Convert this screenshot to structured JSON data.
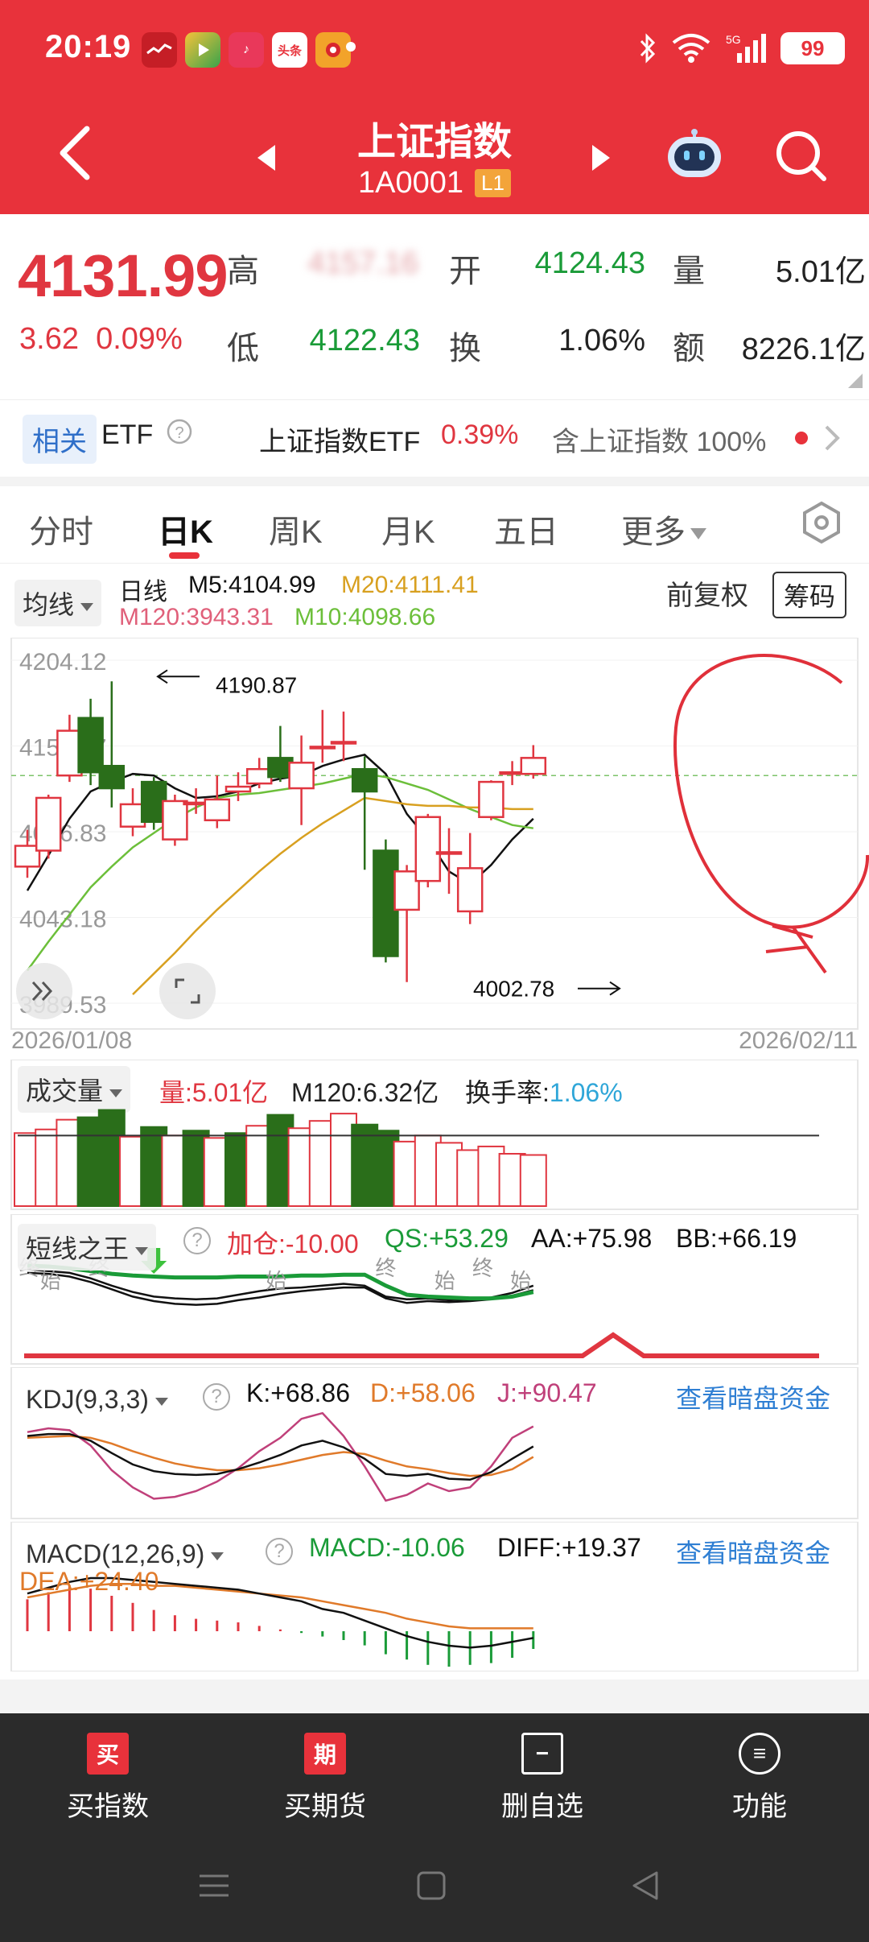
{
  "status_bar": {
    "time": "20:19",
    "battery": "99",
    "network": "5G",
    "app_icons": [
      {
        "name": "app-red-icon",
        "label": "",
        "color": "#d9262d"
      },
      {
        "name": "video-app-icon",
        "label": "",
        "color": "#3aa34b"
      },
      {
        "name": "music-app-icon",
        "label": "♪",
        "color": "#e9385a"
      },
      {
        "name": "toutiao-app-icon",
        "label": "头条",
        "color": "#ef3b3b"
      },
      {
        "name": "news-app-icon",
        "label": "",
        "color": "#f2a32a"
      }
    ]
  },
  "header": {
    "title": "上证指数",
    "code": "1A0001",
    "level": "L1",
    "bg_color": "#e8323b"
  },
  "quote": {
    "price": "4131.99",
    "change": "3.62",
    "change_pct": "0.09%",
    "labels": {
      "high": "高",
      "open": "开",
      "volume": "量",
      "low": "低",
      "turnover": "换",
      "amount": "额"
    },
    "high": "4157.16",
    "open": "4124.43",
    "volume": "5.01亿",
    "low": "4122.43",
    "turnover": "1.06%",
    "amount": "8226.1亿"
  },
  "etf": {
    "tag": "相关",
    "label": "ETF",
    "name": "上证指数ETF",
    "pct": "0.39%",
    "holding": "含上证指数 100%"
  },
  "tabs": [
    {
      "label": "分时"
    },
    {
      "label": "日K",
      "active": true
    },
    {
      "label": "周K"
    },
    {
      "label": "月K"
    },
    {
      "label": "五日"
    },
    {
      "label": "更多"
    }
  ],
  "ma_bar": {
    "selector": "均线",
    "period": "日线",
    "m5": "M5:4104.99",
    "m20": "M20:4111.41",
    "m120": "M120:3943.31",
    "m10": "M10:4098.66",
    "adjust": "前复权",
    "chips": "筹码"
  },
  "colors": {
    "up": "#e03640",
    "down": "#2a6e1a",
    "m5": "#111111",
    "m10": "#6cbf3a",
    "m20": "#d8a020",
    "m120": "#e0607a",
    "annotation": "#e0303a"
  },
  "kline_chart": {
    "y_ticks": [
      "4204.12",
      "4150.47",
      "4096.83",
      "4043.18",
      "3989.53"
    ],
    "date_start": "2026/01/08",
    "date_end": "2026/02/11",
    "high_mark": "4190.87",
    "low_mark": "4002.78"
  },
  "chart_data": {
    "type": "candlestick",
    "x": [
      "2026/01/08",
      "",
      "",
      "",
      "",
      "",
      "",
      "",
      "",
      "",
      "",
      "",
      "",
      "",
      "",
      "",
      "",
      "",
      "",
      "",
      "",
      "",
      "",
      "",
      "2026/02/11"
    ],
    "ylim": [
      3989.53,
      4204.12
    ],
    "y_ticks": [
      4204.12,
      4150.47,
      4096.83,
      4043.18,
      3989.53
    ],
    "candles": [
      {
        "o": 4075,
        "c": 4088,
        "h": 4098,
        "l": 4068
      },
      {
        "o": 4085,
        "c": 4118,
        "h": 4120,
        "l": 4080
      },
      {
        "o": 4132,
        "c": 4160,
        "h": 4170,
        "l": 4128
      },
      {
        "o": 4168,
        "c": 4134,
        "h": 4180,
        "l": 4126
      },
      {
        "o": 4138,
        "c": 4124,
        "h": 4190.87,
        "l": 4112
      },
      {
        "o": 4100,
        "c": 4114,
        "h": 4124,
        "l": 4094
      },
      {
        "o": 4128,
        "c": 4103,
        "h": 4131,
        "l": 4098
      },
      {
        "o": 4092,
        "c": 4116,
        "h": 4120,
        "l": 4088
      },
      {
        "o": 4114,
        "c": 4115,
        "h": 4124,
        "l": 4108
      },
      {
        "o": 4104,
        "c": 4117,
        "h": 4132,
        "l": 4099
      },
      {
        "o": 4122,
        "c": 4125,
        "h": 4134,
        "l": 4116
      },
      {
        "o": 4127,
        "c": 4136,
        "h": 4143,
        "l": 4124
      },
      {
        "o": 4143,
        "c": 4131,
        "h": 4163,
        "l": 4128
      },
      {
        "o": 4124,
        "c": 4140,
        "h": 4157,
        "l": 4101
      },
      {
        "o": 4149,
        "c": 4150,
        "h": 4173,
        "l": 4140
      },
      {
        "o": 4152,
        "c": 4153,
        "h": 4172,
        "l": 4141
      },
      {
        "o": 4136,
        "c": 4122,
        "h": 4144,
        "l": 4073
      },
      {
        "o": 4085,
        "c": 4019,
        "h": 4092,
        "l": 4015
      },
      {
        "o": 4048,
        "c": 4072,
        "h": 4076,
        "l": 4002.78
      },
      {
        "o": 4066,
        "c": 4106,
        "h": 4108,
        "l": 4062
      },
      {
        "o": 4083,
        "c": 4084,
        "h": 4099,
        "l": 4058
      },
      {
        "o": 4047,
        "c": 4074,
        "h": 4096,
        "l": 4039
      },
      {
        "o": 4106,
        "c": 4128,
        "h": 4129,
        "l": 4104
      },
      {
        "o": 4133,
        "c": 4134,
        "h": 4141,
        "l": 4126
      },
      {
        "o": 4133,
        "c": 4143,
        "h": 4151,
        "l": 4130
      }
    ],
    "series": [
      {
        "name": "M5",
        "values": [
          4060,
          4082,
          4105,
          4122,
          4128,
          4133,
          4132,
          4124,
          4118,
          4119,
          4122,
          4127,
          4130,
          4132,
          4138,
          4142,
          4145,
          4133,
          4108,
          4092,
          4072,
          4064,
          4076,
          4092,
          4105
        ]
      },
      {
        "name": "M10",
        "values": [
          4010,
          4028,
          4045,
          4062,
          4075,
          4087,
          4096,
          4105,
          4112,
          4118,
          4120,
          4121,
          4123,
          4125,
          4127,
          4130,
          4133,
          4131,
          4127,
          4123,
          4117,
          4111,
          4106,
          4101,
          4099
        ]
      },
      {
        "name": "M20",
        "values": [
          null,
          null,
          null,
          null,
          null,
          3995,
          4008,
          4021,
          4035,
          4048,
          4060,
          4072,
          4083,
          4093,
          4102,
          4110,
          4118,
          4116,
          4114,
          4113,
          4113,
          4112,
          4112,
          4111,
          4111
        ]
      },
      {
        "name": "M120",
        "values": []
      }
    ]
  },
  "volume_panel": {
    "selector": "成交量",
    "vol": "量:5.01亿",
    "m120": "M120:6.32亿",
    "turnover_label": "换手率:",
    "turnover_val": "1.06%",
    "bars": [
      {
        "v": 6.0,
        "up": true
      },
      {
        "v": 6.3,
        "up": true
      },
      {
        "v": 7.1,
        "up": true
      },
      {
        "v": 7.3,
        "up": false
      },
      {
        "v": 7.9,
        "up": false
      },
      {
        "v": 5.7,
        "up": true
      },
      {
        "v": 6.5,
        "up": false
      },
      {
        "v": 5.8,
        "up": true
      },
      {
        "v": 6.2,
        "up": false
      },
      {
        "v": 5.6,
        "up": true
      },
      {
        "v": 6.0,
        "up": false
      },
      {
        "v": 6.6,
        "up": true
      },
      {
        "v": 7.5,
        "up": false
      },
      {
        "v": 6.4,
        "up": true
      },
      {
        "v": 7.0,
        "up": true
      },
      {
        "v": 7.6,
        "up": true
      },
      {
        "v": 6.7,
        "up": false
      },
      {
        "v": 6.2,
        "up": false
      },
      {
        "v": 5.3,
        "up": true
      },
      {
        "v": 5.8,
        "up": true
      },
      {
        "v": 5.2,
        "up": true
      },
      {
        "v": 4.6,
        "up": true
      },
      {
        "v": 4.9,
        "up": true
      },
      {
        "v": 4.3,
        "up": true
      },
      {
        "v": 4.2,
        "up": true
      }
    ],
    "ref_level": 5.8,
    "max": 8.6
  },
  "dxzw_panel": {
    "selector": "短线之王",
    "jc": "加仓:-10.00",
    "qs": "QS:+53.29",
    "aa": "AA:+75.98",
    "bb": "BB:+66.19",
    "marks": [
      {
        "text": "终",
        "i": 0.1
      },
      {
        "text": "始",
        "i": 1.1
      },
      {
        "text": "终",
        "i": 3.4
      },
      {
        "text": "始",
        "i": 11.8
      },
      {
        "text": "终",
        "i": 17.0
      },
      {
        "text": "始",
        "i": 19.8
      },
      {
        "text": "终",
        "i": 21.6
      },
      {
        "text": "始",
        "i": 23.4
      }
    ],
    "down_arrow_i": 6.0,
    "qs_line": [
      92,
      91,
      89,
      86,
      83,
      81,
      80,
      79,
      79,
      79,
      80,
      80,
      80,
      81,
      81,
      82,
      82,
      70,
      60,
      58,
      57,
      56,
      56,
      58,
      63
    ],
    "aa_line": [
      88,
      86,
      84,
      78,
      70,
      63,
      58,
      56,
      55,
      56,
      60,
      64,
      67,
      68,
      70,
      72,
      70,
      58,
      55,
      56,
      54,
      55,
      57,
      62,
      70
    ],
    "bb_line": [
      84,
      83,
      80,
      74,
      66,
      58,
      53,
      50,
      49,
      50,
      54,
      57,
      61,
      64,
      66,
      68,
      68,
      56,
      51,
      53,
      52,
      53,
      55,
      59,
      65
    ]
  },
  "kdj_panel": {
    "selector": "KDJ(9,3,3)",
    "k": "K:+68.86",
    "d": "D:+58.06",
    "j": "J:+90.47",
    "link": "查看暗盘资金",
    "k_line": [
      80,
      82,
      82,
      75,
      62,
      50,
      43,
      40,
      39,
      40,
      45,
      52,
      60,
      70,
      75,
      68,
      56,
      40,
      38,
      40,
      35,
      34,
      42,
      56,
      69
    ],
    "d_line": [
      78,
      79,
      80,
      78,
      72,
      64,
      57,
      51,
      47,
      44,
      44,
      46,
      50,
      55,
      60,
      63,
      61,
      54,
      48,
      45,
      41,
      38,
      39,
      45,
      58
    ],
    "j_line": [
      84,
      88,
      86,
      70,
      44,
      26,
      14,
      16,
      22,
      32,
      46,
      64,
      78,
      98,
      104,
      80,
      48,
      12,
      18,
      30,
      22,
      26,
      48,
      78,
      90
    ]
  },
  "macd_panel": {
    "selector": "MACD(12,26,9)",
    "macd": "MACD:-10.06",
    "diff": "DIFF:+19.37",
    "dea": "DEA:+24.40",
    "link": "查看暗盘资金",
    "diff_line": [
      42,
      45,
      48,
      50,
      50,
      49,
      48,
      47,
      46,
      45,
      44,
      42,
      40,
      38,
      34,
      32,
      28,
      24,
      20,
      17,
      15,
      14,
      15,
      17,
      19
    ],
    "dea_line": [
      40,
      42,
      44,
      46,
      47,
      47,
      46,
      46,
      45,
      44,
      43,
      42,
      41,
      40,
      38,
      36,
      34,
      32,
      29,
      27,
      25,
      24,
      24,
      24,
      24
    ],
    "hist": [
      18,
      22,
      26,
      24,
      20,
      16,
      12,
      9,
      7,
      6,
      5,
      3,
      1,
      -1,
      -3,
      -5,
      -8,
      -13,
      -16,
      -19,
      -20,
      -19,
      -18,
      -15,
      -10
    ]
  },
  "bottom_bar": [
    {
      "name": "buy-index-button",
      "icon": "买",
      "label": "买指数"
    },
    {
      "name": "buy-futures-button",
      "icon": "期",
      "label": "买期货"
    },
    {
      "name": "remove-watchlist-button",
      "icon": "−",
      "label": "删自选"
    },
    {
      "name": "functions-button",
      "icon": "≡",
      "label": "功能"
    }
  ]
}
